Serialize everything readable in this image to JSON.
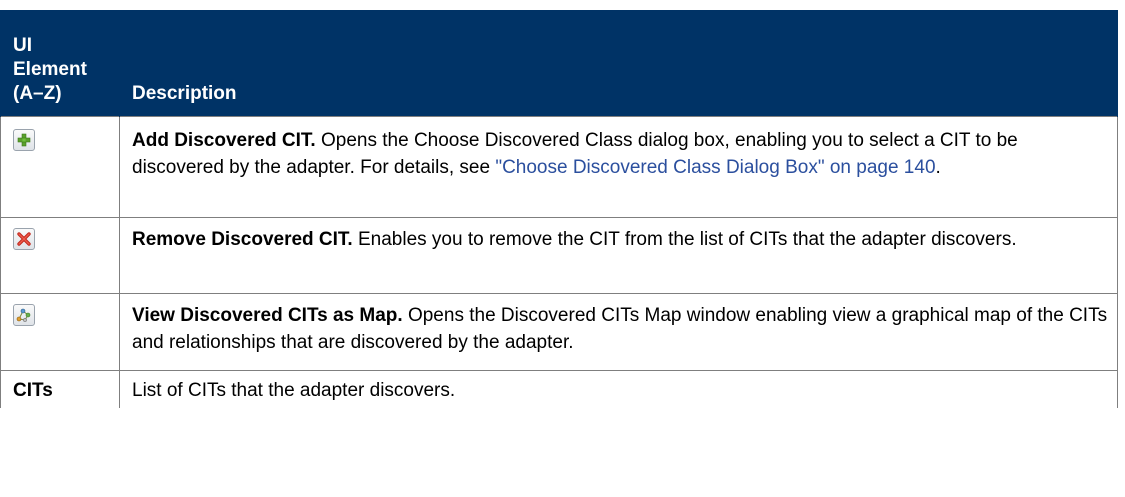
{
  "header": {
    "col1_lines": [
      "UI",
      "Element",
      "(A–Z)"
    ],
    "col2": "Description"
  },
  "rows": [
    {
      "icon": "add-green-plus-icon",
      "lead": "Add Discovered CIT.",
      "text": " Opens the Choose Discovered Class dialog box, enabling you to select a CIT to be discovered by the adapter. For details, see ",
      "link": "\"Choose Discovered Class Dialog Box\" on page 140",
      "tail": "."
    },
    {
      "icon": "remove-red-x-icon",
      "lead": "Remove Discovered CIT.",
      "text": " Enables you to remove the CIT from the list of CITs that the adapter discovers."
    },
    {
      "icon": "view-map-icon",
      "lead": "View Discovered CITs as Map.",
      "text": " Opens the Discovered CITs Map window enabling view a graphical map of the CITs and relationships that are discovered by the adapter."
    },
    {
      "name": "CITs",
      "text": "List of CITs that the adapter discovers."
    }
  ],
  "colors": {
    "header_bg": "#003366",
    "header_text": "#ffffff",
    "link": "#2b4f9e",
    "border": "#7f7f7f"
  }
}
